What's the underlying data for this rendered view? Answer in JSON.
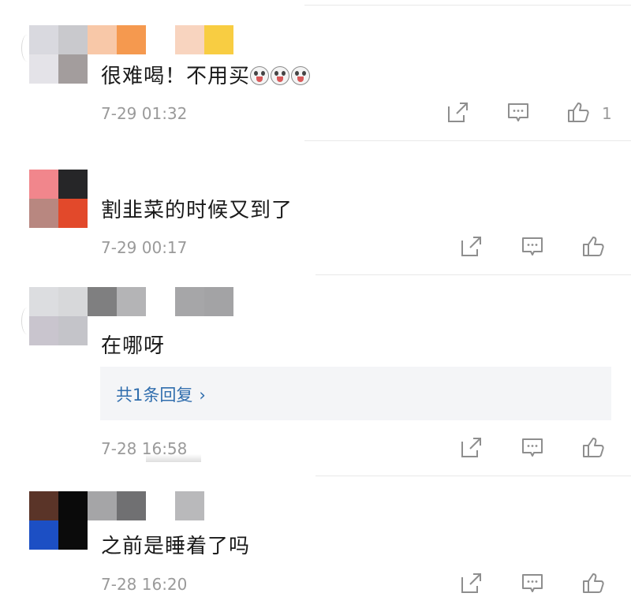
{
  "comments": [
    {
      "text": "很难喝！不用买",
      "emoji_count": 3,
      "emoji_icon": "laughing-crying-face-icon",
      "time": "7-29 01:32",
      "likes": "1"
    },
    {
      "text": "割韭菜的时候又到了",
      "time": "7-29 00:17"
    },
    {
      "text": "在哪呀",
      "time": "7-28 16:58",
      "reply_label": "共1条回复",
      "reply_chevron": "›"
    },
    {
      "text": "之前是睡着了吗",
      "time": "7-28 16:20"
    }
  ],
  "actions": {
    "share_icon": "share-icon",
    "comment_icon": "comment-icon",
    "like_icon": "thumbs-up-icon"
  },
  "colors": {
    "text": "#1a1a1a",
    "meta": "#9a9a9a",
    "link": "#2f6dad",
    "icon": "#8e8e8e"
  }
}
